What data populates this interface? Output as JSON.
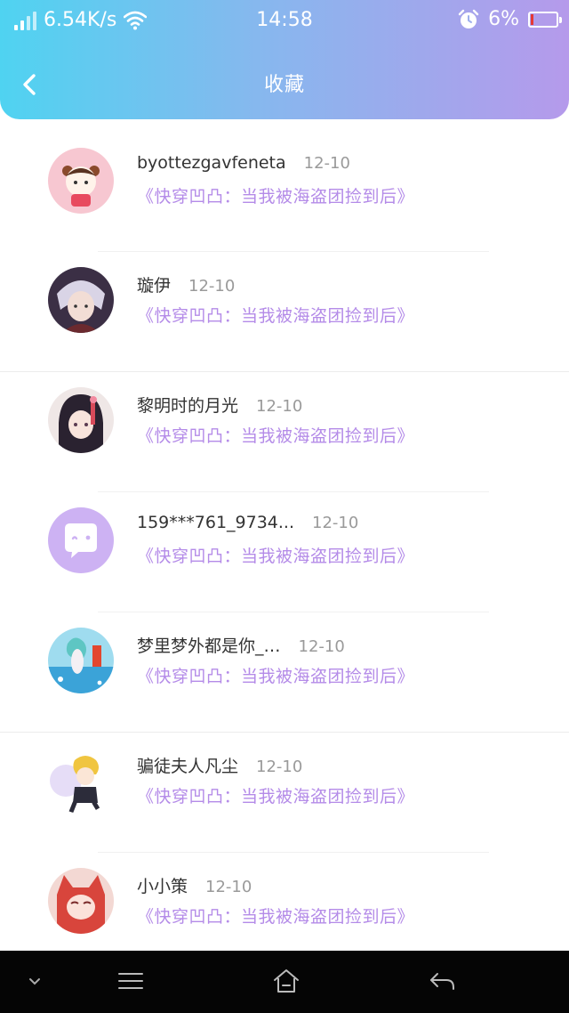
{
  "status_bar": {
    "network_speed": "6.54K/s",
    "time": "14:58",
    "battery_percent": "6%",
    "battery_level": 0.06,
    "icons": [
      "signal-icon",
      "wifi-icon",
      "alarm-icon",
      "battery-icon"
    ]
  },
  "nav": {
    "title": "收藏",
    "back_icon": "chevron-left-icon"
  },
  "list": {
    "items": [
      {
        "name": "byottezgavfeneta",
        "date": "12-10",
        "book": "《快穿凹凸：当我被海盗团捡到后》"
      },
      {
        "name": "璇伊",
        "date": "12-10",
        "book": "《快穿凹凸：当我被海盗团捡到后》"
      },
      {
        "name": "黎明时的月光",
        "date": "12-10",
        "book": "《快穿凹凸：当我被海盗团捡到后》"
      },
      {
        "name": "159***761_9734...",
        "date": "12-10",
        "book": "《快穿凹凸：当我被海盗团捡到后》"
      },
      {
        "name": "梦里梦外都是你_…",
        "date": "12-10",
        "book": "《快穿凹凸：当我被海盗团捡到后》"
      },
      {
        "name": "骗徒夫人凡尘",
        "date": "12-10",
        "book": "《快穿凹凸：当我被海盗团捡到后》"
      },
      {
        "name": "小小策",
        "date": "12-10",
        "book": "《快穿凹凸：当我被海盗团捡到后》"
      }
    ]
  },
  "colors": {
    "header_gradient_start": "#4fd3f1",
    "header_gradient_end": "#b59aeb",
    "book_title": "#b48be8",
    "date_text": "#9a9a9a"
  },
  "bottom_bar": {
    "icons": [
      "chevron-down-icon",
      "menu-icon",
      "home-icon",
      "back-arrow-icon"
    ]
  }
}
